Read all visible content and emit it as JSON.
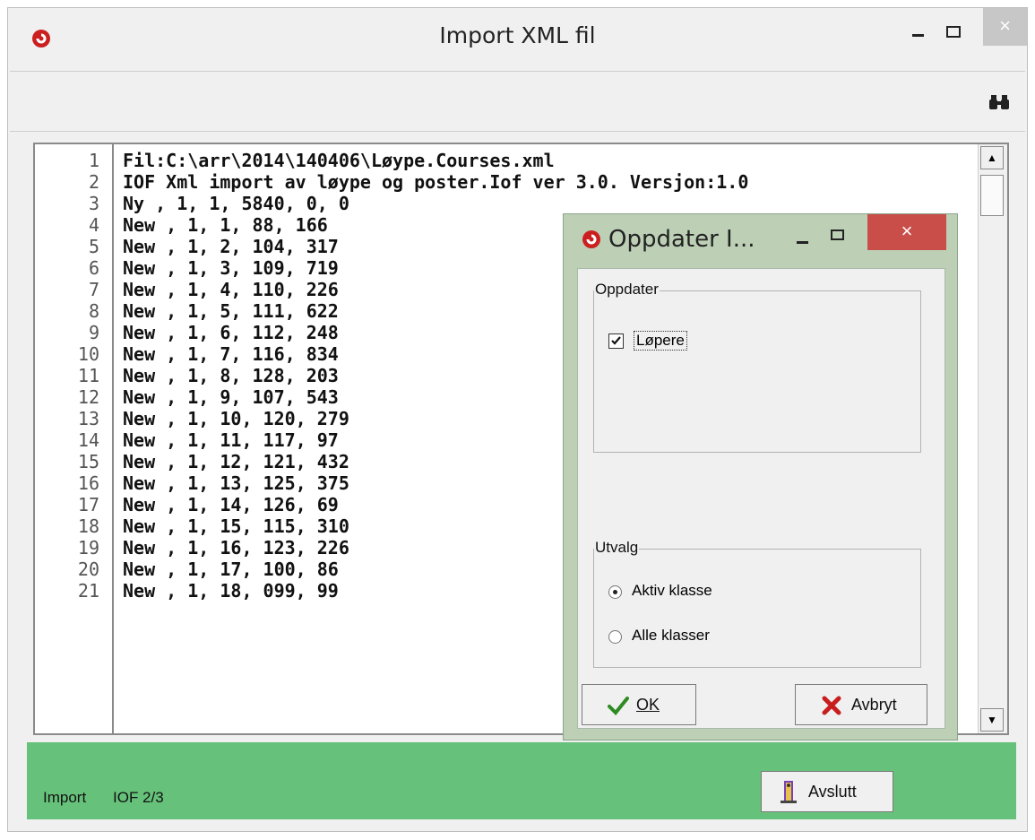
{
  "window": {
    "title": "Import XML fil",
    "close_glyph": "×",
    "icons": [
      "app-icon",
      "minimize-icon",
      "maximize-icon",
      "close-icon",
      "binoculars-icon"
    ]
  },
  "editor": {
    "lines": [
      {
        "num": "1",
        "text": "Fil:C:\\arr\\2014\\140406\\Løype.Courses.xml"
      },
      {
        "num": "2",
        "text": "IOF Xml import av løype og poster.Iof ver 3.0. Versjon:1.0"
      },
      {
        "num": "3",
        "text": "Ny , 1, 1, 5840, 0, 0"
      },
      {
        "num": "4",
        "text": "New , 1, 1, 88, 166"
      },
      {
        "num": "5",
        "text": "New , 1, 2, 104, 317"
      },
      {
        "num": "6",
        "text": "New , 1, 3, 109, 719"
      },
      {
        "num": "7",
        "text": "New , 1, 4, 110, 226"
      },
      {
        "num": "8",
        "text": "New , 1, 5, 111, 622"
      },
      {
        "num": "9",
        "text": "New , 1, 6, 112, 248"
      },
      {
        "num": "10",
        "text": "New , 1, 7, 116, 834"
      },
      {
        "num": "11",
        "text": "New , 1, 8, 128, 203"
      },
      {
        "num": "12",
        "text": "New , 1, 9, 107, 543"
      },
      {
        "num": "13",
        "text": "New , 1, 10, 120, 279"
      },
      {
        "num": "14",
        "text": "New , 1, 11, 117, 97"
      },
      {
        "num": "15",
        "text": "New , 1, 12, 121, 432"
      },
      {
        "num": "16",
        "text": "New , 1, 13, 125, 375"
      },
      {
        "num": "17",
        "text": "New , 1, 14, 126, 69"
      },
      {
        "num": "18",
        "text": "New , 1, 15, 115, 310"
      },
      {
        "num": "19",
        "text": "New , 1, 16, 123, 226"
      },
      {
        "num": "20",
        "text": "New , 1, 17, 100, 86"
      },
      {
        "num": "21",
        "text": "New , 1, 18, 099, 99"
      }
    ],
    "scroll_up_glyph": "▲",
    "scroll_down_glyph": "▼"
  },
  "status": {
    "label1": "Import",
    "label2": "IOF 2/3",
    "exit_button": "Avslutt"
  },
  "dialog": {
    "title": "Oppdater I...",
    "close_glyph": "×",
    "group_update": "Oppdater",
    "checkbox_runners": "Løpere",
    "checkbox_checked": true,
    "group_selection": "Utvalg",
    "radio_active_class": "Aktiv klasse",
    "radio_all_classes": "Alle klasser",
    "selected_radio": "Aktiv klasse",
    "ok_button": "OK",
    "cancel_button": "Avbryt"
  },
  "colors": {
    "status_bar": "#66c17a",
    "dialog_frame": "#bdd0b6",
    "dialog_close": "#c94d49",
    "app_icon": "#cc1f1f",
    "ok_check": "#2e8b22",
    "cancel_x": "#c81e1e"
  }
}
